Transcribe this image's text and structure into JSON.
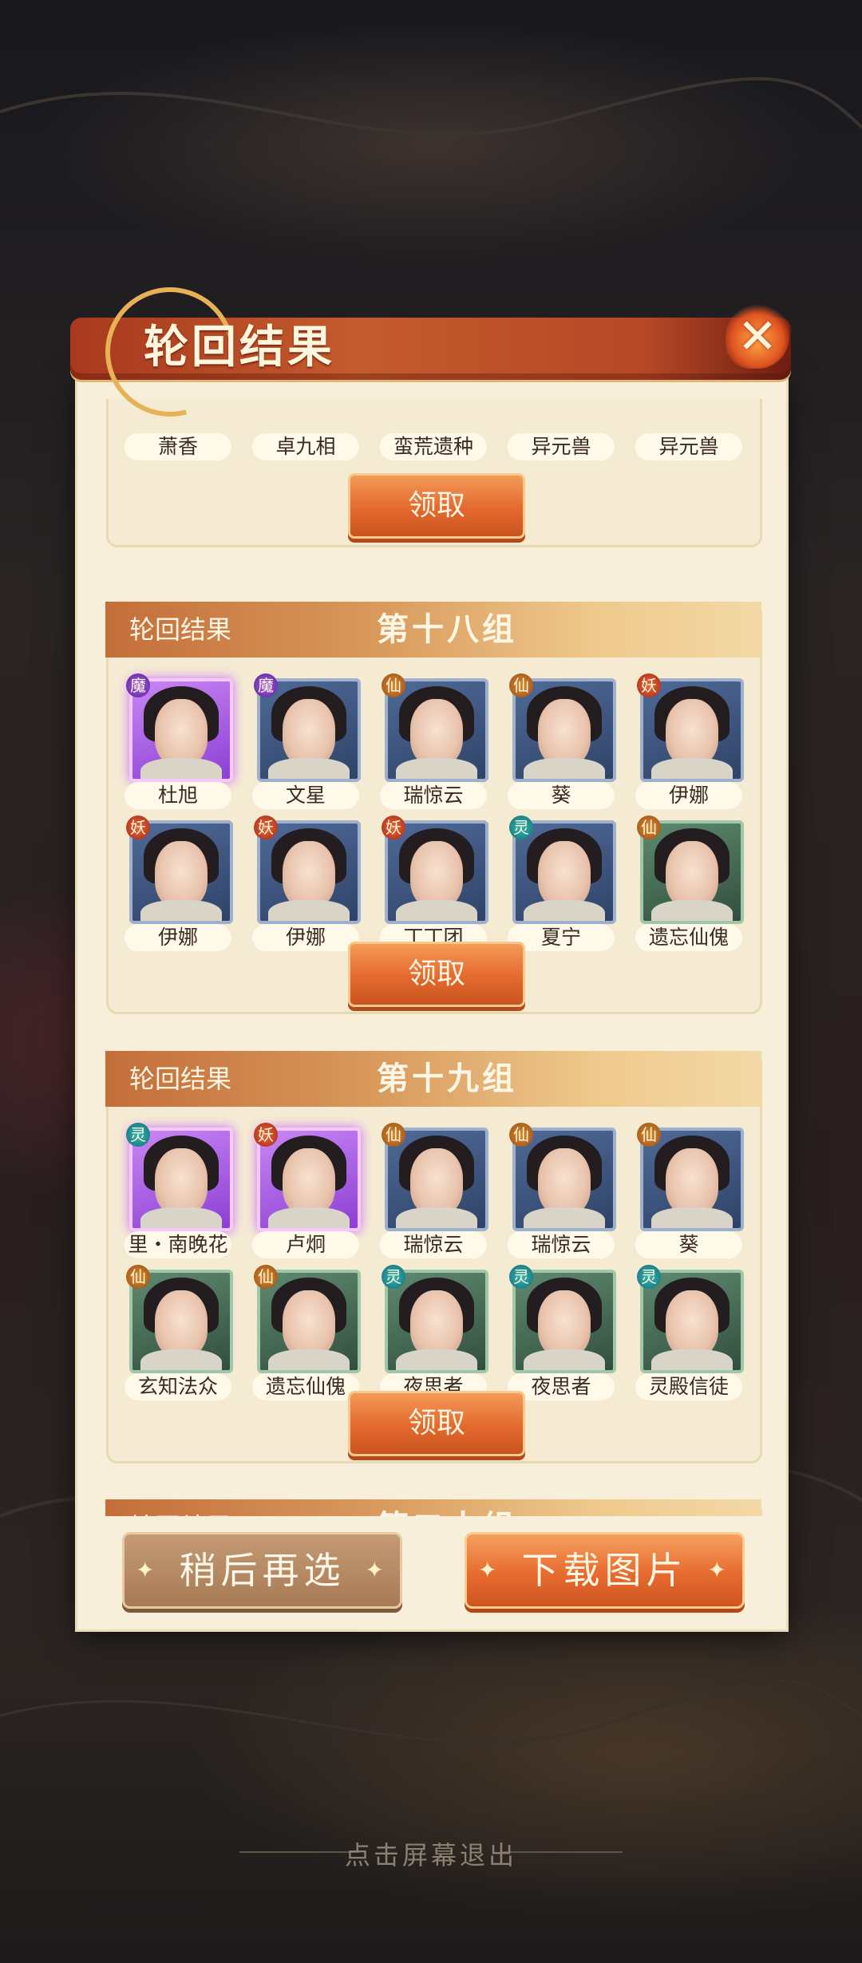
{
  "dialog": {
    "title": "轮回结果",
    "close_icon": "close-icon"
  },
  "groups": [
    {
      "label": "轮回结果",
      "number": "",
      "claim_label": "领取",
      "heroes": [
        {
          "name": "萧香",
          "type": "",
          "rarity": "normal"
        },
        {
          "name": "卓九相",
          "type": "",
          "rarity": "normal"
        },
        {
          "name": "蛮荒遗种",
          "type": "",
          "rarity": "normal"
        },
        {
          "name": "异元兽",
          "type": "",
          "rarity": "normal"
        },
        {
          "name": "异元兽",
          "type": "",
          "rarity": "normal"
        }
      ]
    },
    {
      "label": "轮回结果",
      "number": "第十八组",
      "claim_label": "领取",
      "heroes": [
        {
          "name": "杜旭",
          "type": "魔",
          "rarity": "purple"
        },
        {
          "name": "文星",
          "type": "魔",
          "rarity": "normal"
        },
        {
          "name": "瑞惊云",
          "type": "仙",
          "rarity": "normal"
        },
        {
          "name": "葵",
          "type": "仙",
          "rarity": "normal"
        },
        {
          "name": "伊娜",
          "type": "妖",
          "rarity": "normal"
        },
        {
          "name": "伊娜",
          "type": "妖",
          "rarity": "normal"
        },
        {
          "name": "伊娜",
          "type": "妖",
          "rarity": "normal"
        },
        {
          "name": "丁丁团",
          "type": "妖",
          "rarity": "normal"
        },
        {
          "name": "夏宁",
          "type": "灵",
          "rarity": "normal"
        },
        {
          "name": "遗忘仙傀",
          "type": "仙",
          "rarity": "green"
        }
      ]
    },
    {
      "label": "轮回结果",
      "number": "第十九组",
      "claim_label": "领取",
      "heroes": [
        {
          "name": "里・南晚花",
          "type": "灵",
          "rarity": "purple"
        },
        {
          "name": "卢炯",
          "type": "妖",
          "rarity": "purple"
        },
        {
          "name": "瑞惊云",
          "type": "仙",
          "rarity": "normal"
        },
        {
          "name": "瑞惊云",
          "type": "仙",
          "rarity": "normal"
        },
        {
          "name": "葵",
          "type": "仙",
          "rarity": "normal"
        },
        {
          "name": "玄知法众",
          "type": "仙",
          "rarity": "green"
        },
        {
          "name": "遗忘仙傀",
          "type": "仙",
          "rarity": "green"
        },
        {
          "name": "夜思者",
          "type": "灵",
          "rarity": "green"
        },
        {
          "name": "夜思者",
          "type": "灵",
          "rarity": "green"
        },
        {
          "name": "灵殿信徒",
          "type": "灵",
          "rarity": "green"
        }
      ]
    },
    {
      "label": "轮回结果",
      "number": "第二十组",
      "claim_label": "",
      "heroes": []
    }
  ],
  "buttons": {
    "later": "稍后再选",
    "download": "下载图片"
  },
  "exit_hint": "点击屏幕退出"
}
